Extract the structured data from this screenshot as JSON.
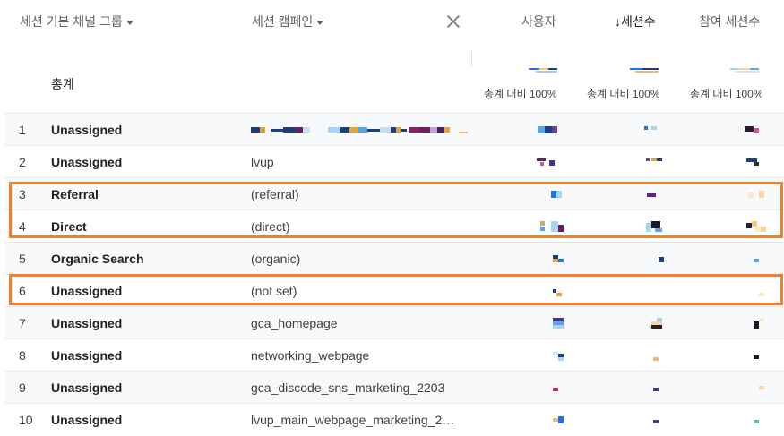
{
  "header": {
    "dimension1_label": "세션 기본 채널 그룹",
    "dimension2_label": "세션 캠페인",
    "metric_users": "사용자",
    "metric_sessions": "↓세션수",
    "metric_engaged": "참여 세션수",
    "total_label": "총계",
    "pct_users": "총계 대비 100%",
    "pct_sessions": "총계 대비 100%",
    "pct_engaged": "총계 대비 100%"
  },
  "rows": [
    {
      "num": "1",
      "channel": "Unassigned",
      "campaign": ""
    },
    {
      "num": "2",
      "channel": "Unassigned",
      "campaign": "lvup"
    },
    {
      "num": "3",
      "channel": "Referral",
      "campaign": "(referral)"
    },
    {
      "num": "4",
      "channel": "Direct",
      "campaign": "(direct)"
    },
    {
      "num": "5",
      "channel": "Organic Search",
      "campaign": "(organic)"
    },
    {
      "num": "6",
      "channel": "Unassigned",
      "campaign": "(not set)"
    },
    {
      "num": "7",
      "channel": "Unassigned",
      "campaign": "gca_homepage"
    },
    {
      "num": "8",
      "channel": "Unassigned",
      "campaign": "networking_webpage"
    },
    {
      "num": "9",
      "channel": "Unassigned",
      "campaign": "gca_discode_sns_marketing_2203"
    },
    {
      "num": "10",
      "channel": "Unassigned",
      "campaign": "lvup_main_webpage_marketing_2…"
    }
  ],
  "colors": {
    "highlight": "#f47f2b",
    "row_shade": "#f8f9fa"
  }
}
